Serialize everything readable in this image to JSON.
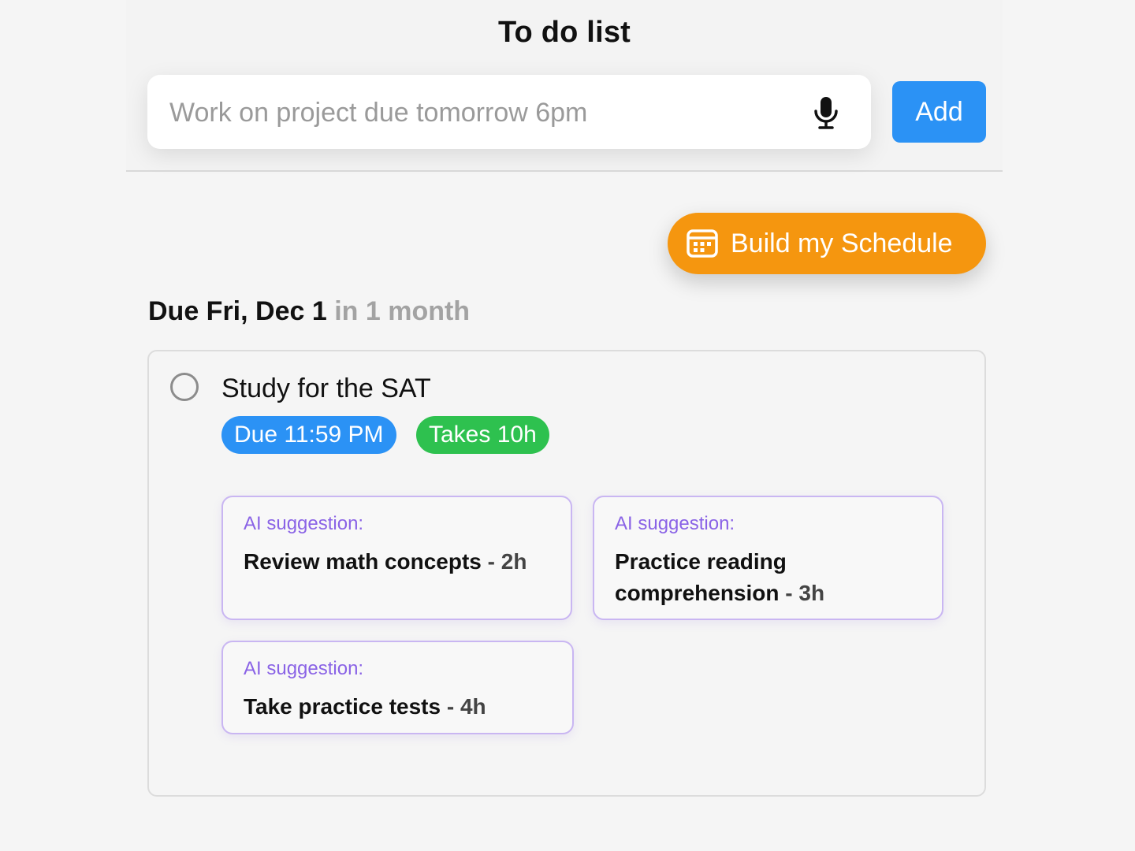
{
  "header": {
    "title": "To do list",
    "input": {
      "value": "",
      "placeholder": "Work on project due tomorrow 6pm"
    },
    "add_label": "Add"
  },
  "schedule_button": {
    "label": "Build my Schedule"
  },
  "group": {
    "due_label": "Due Fri, Dec 1",
    "relative": "in 1 month",
    "task": {
      "title": "Study for the SAT",
      "due_badge": "Due 11:59 PM",
      "takes_badge": "Takes 10h",
      "suggestions": [
        {
          "label": "AI suggestion:",
          "name": "Review math concepts",
          "duration": "- 2h"
        },
        {
          "label": "AI suggestion:",
          "name": "Practice reading comprehension",
          "duration": "- 3h"
        },
        {
          "label": "AI suggestion:",
          "name": "Take practice tests",
          "duration": "- 4h"
        }
      ]
    }
  },
  "colors": {
    "primary_blue": "#2b92f5",
    "green": "#2ec14f",
    "orange": "#f5960f",
    "ai_purple": "#8a63e6"
  },
  "icons": {
    "mic": "microphone-icon",
    "calendar": "calendar-icon",
    "checkbox": "circle-checkbox"
  }
}
